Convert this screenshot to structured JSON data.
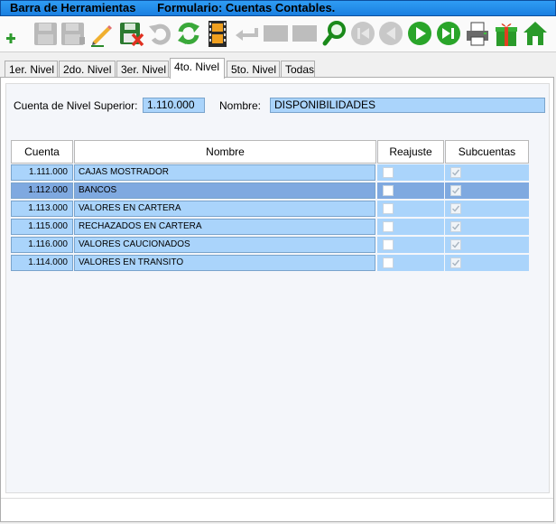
{
  "titlebar": {
    "left": "Barra de Herramientas",
    "right": "Formulario: Cuentas Contables."
  },
  "toolbar": {
    "buttons": [
      {
        "name": "add-icon",
        "enabled": true
      },
      {
        "name": "save-icon",
        "enabled": false
      },
      {
        "name": "save-as-icon",
        "enabled": false
      },
      {
        "name": "pencil-icon",
        "enabled": true
      },
      {
        "name": "delete-icon",
        "enabled": true
      },
      {
        "name": "undo-icon",
        "enabled": false
      },
      {
        "name": "refresh-icon",
        "enabled": true
      },
      {
        "name": "film-icon",
        "enabled": true
      },
      {
        "name": "return-icon",
        "enabled": false
      },
      {
        "name": "blank-icon",
        "enabled": false
      },
      {
        "name": "blank-icon",
        "enabled": false
      },
      {
        "name": "search-icon",
        "enabled": true
      },
      {
        "name": "first-icon",
        "enabled": false
      },
      {
        "name": "previous-icon",
        "enabled": false
      },
      {
        "name": "next-icon",
        "enabled": true
      },
      {
        "name": "last-icon",
        "enabled": true
      },
      {
        "name": "printer-icon",
        "enabled": true
      },
      {
        "name": "gift-icon",
        "enabled": true
      },
      {
        "name": "home-icon",
        "enabled": true
      }
    ]
  },
  "tabs": [
    {
      "label": "1er. Nivel",
      "active": false
    },
    {
      "label": "2do. Nivel",
      "active": false
    },
    {
      "label": "3er. Nivel",
      "active": false
    },
    {
      "label": "4to. Nivel",
      "active": true
    },
    {
      "label": "5to. Nivel",
      "active": false
    },
    {
      "label": "Todas",
      "active": false
    }
  ],
  "form": {
    "parent_label": "Cuenta de Nivel Superior:",
    "parent_value": "1.110.000",
    "name_label": "Nombre:",
    "name_value": "DISPONIBILIDADES"
  },
  "grid": {
    "columns": [
      "Cuenta",
      "Nombre",
      "Reajuste",
      "Subcuentas"
    ],
    "rows": [
      {
        "code": "1.111.000",
        "name": "CAJAS MOSTRADOR",
        "reajuste": false,
        "subcuentas": true,
        "selected": false
      },
      {
        "code": "1.112.000",
        "name": "BANCOS",
        "reajuste": false,
        "subcuentas": true,
        "selected": true
      },
      {
        "code": "1.113.000",
        "name": "VALORES EN CARTERA",
        "reajuste": false,
        "subcuentas": true,
        "selected": false
      },
      {
        "code": "1.115.000",
        "name": "RECHAZADOS EN CARTERA",
        "reajuste": false,
        "subcuentas": true,
        "selected": false
      },
      {
        "code": "1.116.000",
        "name": "VALORES CAUCIONADOS",
        "reajuste": false,
        "subcuentas": true,
        "selected": false
      },
      {
        "code": "1.114.000",
        "name": "VALORES EN TRANSITO",
        "reajuste": false,
        "subcuentas": true,
        "selected": false
      }
    ]
  }
}
